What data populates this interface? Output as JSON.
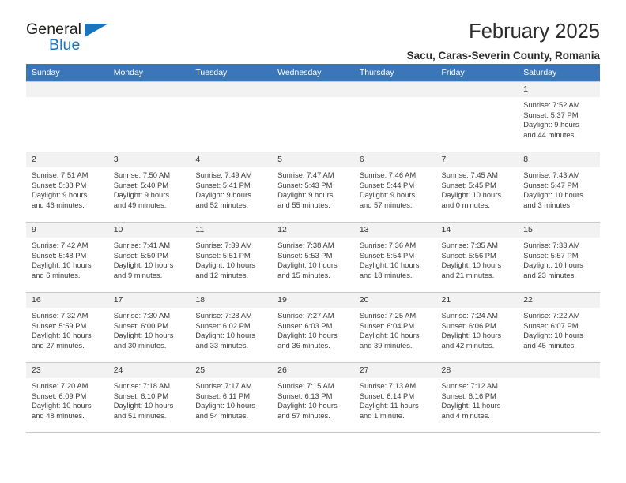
{
  "brand": {
    "name_part1": "General",
    "name_part2": "Blue",
    "triangle_color": "#1b75bc"
  },
  "header": {
    "title": "February 2025",
    "subtitle": "Sacu, Caras-Severin County, Romania"
  },
  "theme": {
    "header_blue": "#3a76b8",
    "daynum_bg": "#f2f2f2",
    "grid_line": "#c8c8c8"
  },
  "weekday_headers": [
    "Sunday",
    "Monday",
    "Tuesday",
    "Wednesday",
    "Thursday",
    "Friday",
    "Saturday"
  ],
  "weeks": [
    [
      {
        "day": "",
        "sunrise": "",
        "sunset": "",
        "daylight1": "",
        "daylight2": ""
      },
      {
        "day": "",
        "sunrise": "",
        "sunset": "",
        "daylight1": "",
        "daylight2": ""
      },
      {
        "day": "",
        "sunrise": "",
        "sunset": "",
        "daylight1": "",
        "daylight2": ""
      },
      {
        "day": "",
        "sunrise": "",
        "sunset": "",
        "daylight1": "",
        "daylight2": ""
      },
      {
        "day": "",
        "sunrise": "",
        "sunset": "",
        "daylight1": "",
        "daylight2": ""
      },
      {
        "day": "",
        "sunrise": "",
        "sunset": "",
        "daylight1": "",
        "daylight2": ""
      },
      {
        "day": "1",
        "sunrise": "Sunrise: 7:52 AM",
        "sunset": "Sunset: 5:37 PM",
        "daylight1": "Daylight: 9 hours",
        "daylight2": "and 44 minutes."
      }
    ],
    [
      {
        "day": "2",
        "sunrise": "Sunrise: 7:51 AM",
        "sunset": "Sunset: 5:38 PM",
        "daylight1": "Daylight: 9 hours",
        "daylight2": "and 46 minutes."
      },
      {
        "day": "3",
        "sunrise": "Sunrise: 7:50 AM",
        "sunset": "Sunset: 5:40 PM",
        "daylight1": "Daylight: 9 hours",
        "daylight2": "and 49 minutes."
      },
      {
        "day": "4",
        "sunrise": "Sunrise: 7:49 AM",
        "sunset": "Sunset: 5:41 PM",
        "daylight1": "Daylight: 9 hours",
        "daylight2": "and 52 minutes."
      },
      {
        "day": "5",
        "sunrise": "Sunrise: 7:47 AM",
        "sunset": "Sunset: 5:43 PM",
        "daylight1": "Daylight: 9 hours",
        "daylight2": "and 55 minutes."
      },
      {
        "day": "6",
        "sunrise": "Sunrise: 7:46 AM",
        "sunset": "Sunset: 5:44 PM",
        "daylight1": "Daylight: 9 hours",
        "daylight2": "and 57 minutes."
      },
      {
        "day": "7",
        "sunrise": "Sunrise: 7:45 AM",
        "sunset": "Sunset: 5:45 PM",
        "daylight1": "Daylight: 10 hours",
        "daylight2": "and 0 minutes."
      },
      {
        "day": "8",
        "sunrise": "Sunrise: 7:43 AM",
        "sunset": "Sunset: 5:47 PM",
        "daylight1": "Daylight: 10 hours",
        "daylight2": "and 3 minutes."
      }
    ],
    [
      {
        "day": "9",
        "sunrise": "Sunrise: 7:42 AM",
        "sunset": "Sunset: 5:48 PM",
        "daylight1": "Daylight: 10 hours",
        "daylight2": "and 6 minutes."
      },
      {
        "day": "10",
        "sunrise": "Sunrise: 7:41 AM",
        "sunset": "Sunset: 5:50 PM",
        "daylight1": "Daylight: 10 hours",
        "daylight2": "and 9 minutes."
      },
      {
        "day": "11",
        "sunrise": "Sunrise: 7:39 AM",
        "sunset": "Sunset: 5:51 PM",
        "daylight1": "Daylight: 10 hours",
        "daylight2": "and 12 minutes."
      },
      {
        "day": "12",
        "sunrise": "Sunrise: 7:38 AM",
        "sunset": "Sunset: 5:53 PM",
        "daylight1": "Daylight: 10 hours",
        "daylight2": "and 15 minutes."
      },
      {
        "day": "13",
        "sunrise": "Sunrise: 7:36 AM",
        "sunset": "Sunset: 5:54 PM",
        "daylight1": "Daylight: 10 hours",
        "daylight2": "and 18 minutes."
      },
      {
        "day": "14",
        "sunrise": "Sunrise: 7:35 AM",
        "sunset": "Sunset: 5:56 PM",
        "daylight1": "Daylight: 10 hours",
        "daylight2": "and 21 minutes."
      },
      {
        "day": "15",
        "sunrise": "Sunrise: 7:33 AM",
        "sunset": "Sunset: 5:57 PM",
        "daylight1": "Daylight: 10 hours",
        "daylight2": "and 23 minutes."
      }
    ],
    [
      {
        "day": "16",
        "sunrise": "Sunrise: 7:32 AM",
        "sunset": "Sunset: 5:59 PM",
        "daylight1": "Daylight: 10 hours",
        "daylight2": "and 27 minutes."
      },
      {
        "day": "17",
        "sunrise": "Sunrise: 7:30 AM",
        "sunset": "Sunset: 6:00 PM",
        "daylight1": "Daylight: 10 hours",
        "daylight2": "and 30 minutes."
      },
      {
        "day": "18",
        "sunrise": "Sunrise: 7:28 AM",
        "sunset": "Sunset: 6:02 PM",
        "daylight1": "Daylight: 10 hours",
        "daylight2": "and 33 minutes."
      },
      {
        "day": "19",
        "sunrise": "Sunrise: 7:27 AM",
        "sunset": "Sunset: 6:03 PM",
        "daylight1": "Daylight: 10 hours",
        "daylight2": "and 36 minutes."
      },
      {
        "day": "20",
        "sunrise": "Sunrise: 7:25 AM",
        "sunset": "Sunset: 6:04 PM",
        "daylight1": "Daylight: 10 hours",
        "daylight2": "and 39 minutes."
      },
      {
        "day": "21",
        "sunrise": "Sunrise: 7:24 AM",
        "sunset": "Sunset: 6:06 PM",
        "daylight1": "Daylight: 10 hours",
        "daylight2": "and 42 minutes."
      },
      {
        "day": "22",
        "sunrise": "Sunrise: 7:22 AM",
        "sunset": "Sunset: 6:07 PM",
        "daylight1": "Daylight: 10 hours",
        "daylight2": "and 45 minutes."
      }
    ],
    [
      {
        "day": "23",
        "sunrise": "Sunrise: 7:20 AM",
        "sunset": "Sunset: 6:09 PM",
        "daylight1": "Daylight: 10 hours",
        "daylight2": "and 48 minutes."
      },
      {
        "day": "24",
        "sunrise": "Sunrise: 7:18 AM",
        "sunset": "Sunset: 6:10 PM",
        "daylight1": "Daylight: 10 hours",
        "daylight2": "and 51 minutes."
      },
      {
        "day": "25",
        "sunrise": "Sunrise: 7:17 AM",
        "sunset": "Sunset: 6:11 PM",
        "daylight1": "Daylight: 10 hours",
        "daylight2": "and 54 minutes."
      },
      {
        "day": "26",
        "sunrise": "Sunrise: 7:15 AM",
        "sunset": "Sunset: 6:13 PM",
        "daylight1": "Daylight: 10 hours",
        "daylight2": "and 57 minutes."
      },
      {
        "day": "27",
        "sunrise": "Sunrise: 7:13 AM",
        "sunset": "Sunset: 6:14 PM",
        "daylight1": "Daylight: 11 hours",
        "daylight2": "and 1 minute."
      },
      {
        "day": "28",
        "sunrise": "Sunrise: 7:12 AM",
        "sunset": "Sunset: 6:16 PM",
        "daylight1": "Daylight: 11 hours",
        "daylight2": "and 4 minutes."
      },
      {
        "day": "",
        "sunrise": "",
        "sunset": "",
        "daylight1": "",
        "daylight2": ""
      }
    ]
  ]
}
